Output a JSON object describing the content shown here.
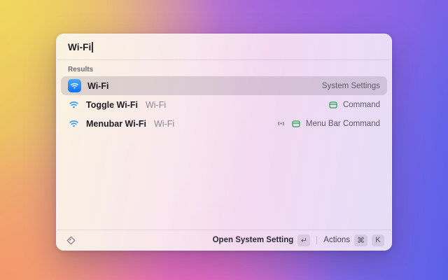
{
  "window": {
    "search": {
      "value": "Wi-Fi",
      "placeholder": ""
    },
    "results_header": "Results",
    "results": [
      {
        "title": "Wi-Fi",
        "subtitle": "",
        "accessory": "System Settings",
        "icon": "wifi-app-icon",
        "selected": true
      },
      {
        "title": "Toggle Wi-Fi",
        "subtitle": "Wi-Fi",
        "accessory": "Command",
        "icon": "wifi-icon",
        "accessory_icons": [
          "command-icon"
        ],
        "selected": false
      },
      {
        "title": "Menubar Wi-Fi",
        "subtitle": "Wi-Fi",
        "accessory": "Menu Bar Command",
        "icon": "wifi-icon",
        "accessory_icons": [
          "menubar-broadcast-icon",
          "command-icon"
        ],
        "selected": false
      }
    ],
    "footer": {
      "logo": "raycast-logo-icon",
      "primary_action": "Open System Setting",
      "primary_key": "↵",
      "actions_label": "Actions",
      "actions_keys": [
        "⌘",
        "K"
      ]
    }
  },
  "colors": {
    "accent_blue": "#0b70f5",
    "wifi_glyph_blue": "#2b9cf2",
    "command_green": "#2eac5b",
    "selection_gray": "#766980",
    "panel_tint_pink": "#f7e0f2"
  }
}
